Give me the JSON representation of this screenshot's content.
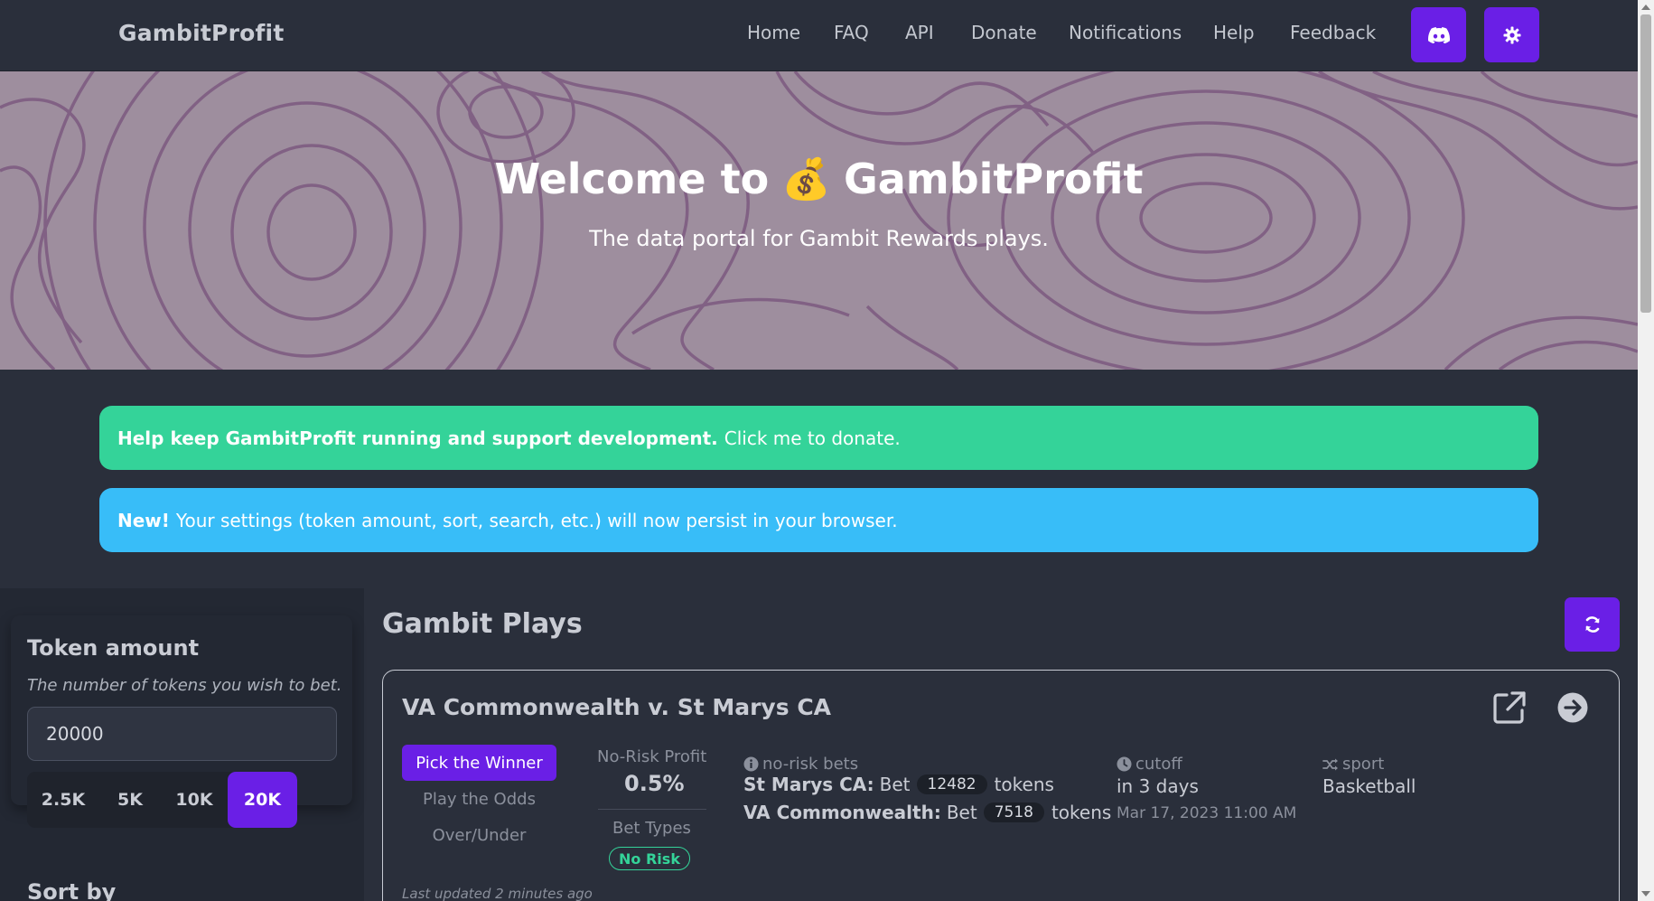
{
  "navbar": {
    "brand": "GambitProfit",
    "links": [
      "Home",
      "FAQ",
      "API",
      "Donate",
      "Notifications",
      "Help",
      "Feedback"
    ],
    "discord_icon": "discord-icon",
    "settings_icon": "gear-icon"
  },
  "hero": {
    "title_prefix": "Welcome to",
    "title_emoji": "💰",
    "title_suffix": "GambitProfit",
    "subtitle": "The data portal for Gambit Rewards plays."
  },
  "alerts": {
    "donate_bold": "Help keep GambitProfit running and support development.",
    "donate_text": "Click me to donate.",
    "new_bold": "New!",
    "new_text": "Your settings (token amount, sort, search, etc.) will now persist in your browser."
  },
  "sidebar": {
    "token_title": "Token amount",
    "token_desc": "The number of tokens you wish to bet.",
    "token_value": "20000",
    "presets": [
      "2.5K",
      "5K",
      "10K",
      "20K"
    ],
    "active_preset": "20K",
    "sort_title": "Sort by"
  },
  "main": {
    "title": "Gambit Plays",
    "refresh_icon": "refresh-icon",
    "play": {
      "title": "VA Commonwealth v. St Marys CA",
      "options": [
        "Pick the Winner",
        "Play the Odds",
        "Over/Under"
      ],
      "profit_label": "No-Risk Profit",
      "profit_value": "0.5%",
      "bet_types_label": "Bet Types",
      "bet_type_badge": "No Risk",
      "bets_label": "no-risk bets",
      "bets": [
        {
          "team": "St Marys CA:",
          "verb": "Bet",
          "amount": "12482",
          "unit": "tokens"
        },
        {
          "team": "VA Commonwealth:",
          "verb": "Bet",
          "amount": "7518",
          "unit": "tokens"
        }
      ],
      "cutoff_label": "cutoff",
      "cutoff_relative": "in 3 days",
      "cutoff_date": "Mar 17, 2023 11:00 AM",
      "sport_label": "sport",
      "sport_value": "Basketball",
      "updated": "Last updated 2 minutes ago"
    }
  },
  "colors": {
    "accent": "#6a1fe6",
    "success": "#34d399",
    "info": "#38bdf8",
    "background": "#2a2f3b"
  }
}
